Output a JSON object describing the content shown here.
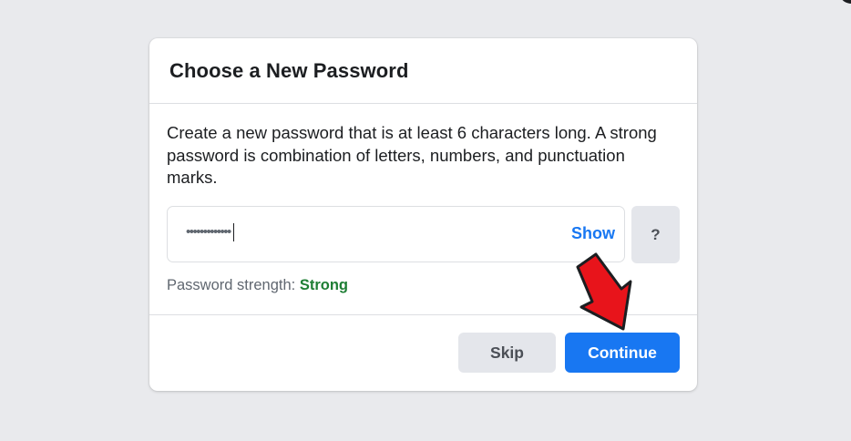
{
  "dialog": {
    "title": "Choose a New Password",
    "description": "Create a new password that is at least 6 characters long. A strong password is combination of letters, numbers, and punctuation marks."
  },
  "password": {
    "masked_value": "•••••••••••••",
    "show_label": "Show",
    "help_label": "?"
  },
  "strength": {
    "label": "Password strength: ",
    "value": "Strong",
    "value_color": "#1e7e34"
  },
  "actions": {
    "skip_label": "Skip",
    "continue_label": "Continue"
  },
  "annotation": {
    "icon": "red-arrow-icon",
    "color": "#e8141b"
  },
  "colors": {
    "accent": "#1877f2",
    "background": "#e9eaed"
  }
}
